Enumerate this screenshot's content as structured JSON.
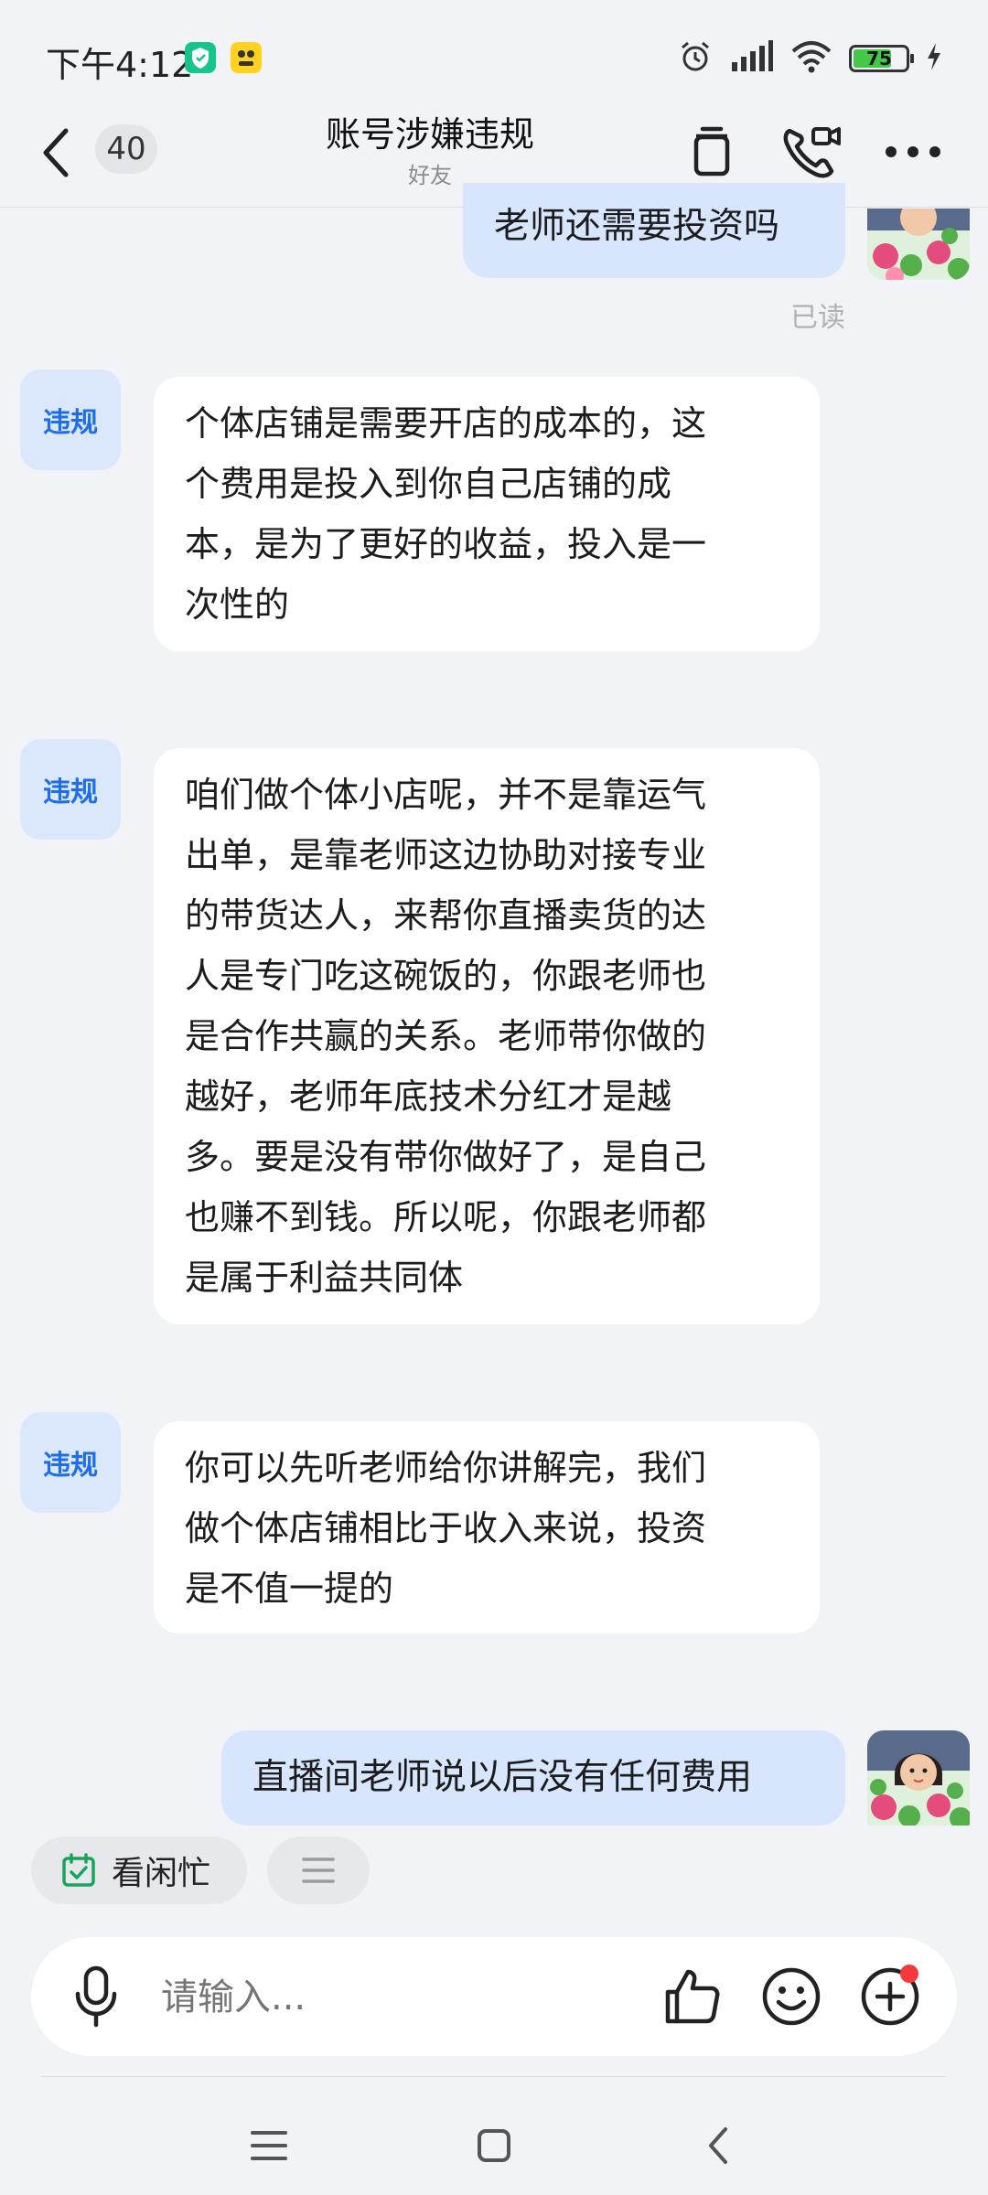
{
  "status_bar": {
    "time": "下午4:12",
    "battery_level": "75",
    "app_icons": [
      "shield-app-icon",
      "yellow-app-icon"
    ],
    "icons": [
      "alarm-icon",
      "signal-icon",
      "wifi-icon",
      "battery-icon",
      "charging-icon"
    ]
  },
  "header": {
    "unread_count": "40",
    "title": "账号涉嫌违规",
    "subtitle": "好友",
    "icons": [
      "back-icon",
      "delete-icon",
      "video-call-icon",
      "more-icon"
    ]
  },
  "messages": [
    {
      "side": "out",
      "text": "老师还需要投资吗",
      "status": "已读"
    },
    {
      "side": "in",
      "sender_tag": "违规",
      "lines": [
        "个体店铺是需要开店的成本的，这",
        "个费用是投入到你自己店铺的成",
        "本，是为了更好的收益，投入是一",
        "次性的"
      ]
    },
    {
      "side": "in",
      "sender_tag": "违规",
      "lines": [
        "咱们做个体小店呢，并不是靠运气",
        "出单，是靠老师这边协助对接专业",
        "的带货达人，来帮你直播卖货的达",
        "人是专门吃这碗饭的，你跟老师也",
        "是合作共赢的关系。老师带你做的",
        "越好，老师年底技术分红才是越",
        "多。要是没有带你做好了，是自己",
        "也赚不到钱。所以呢，你跟老师都",
        "是属于利益共同体"
      ]
    },
    {
      "side": "in",
      "sender_tag": "违规",
      "lines": [
        "你可以先听老师给你讲解完，我们",
        "做个体店铺相比于收入来说，投资",
        "是不值一提的"
      ]
    },
    {
      "side": "out",
      "text": "直播间老师说以后没有任何费用"
    }
  ],
  "quick_actions": {
    "chip1_label": "看闲忙",
    "chip1_icon": "calendar-check-icon",
    "chip2_icon": "menu-icon"
  },
  "input_bar": {
    "placeholder": "请输入...",
    "icons": [
      "microphone-icon",
      "thumbs-up-icon",
      "emoji-icon",
      "plus-icon"
    ]
  },
  "nav_bar": {
    "icons": [
      "recents-icon",
      "home-icon",
      "back-nav-icon"
    ]
  },
  "colors": {
    "background": "#f2f3f7",
    "outgoing_bubble": "#d8e6fd",
    "incoming_bubble": "#ffffff",
    "tag_bg": "#dbe8fb",
    "tag_text": "#1f6ee8",
    "notification_dot": "#f4393d",
    "battery_green": "#45c84a"
  }
}
